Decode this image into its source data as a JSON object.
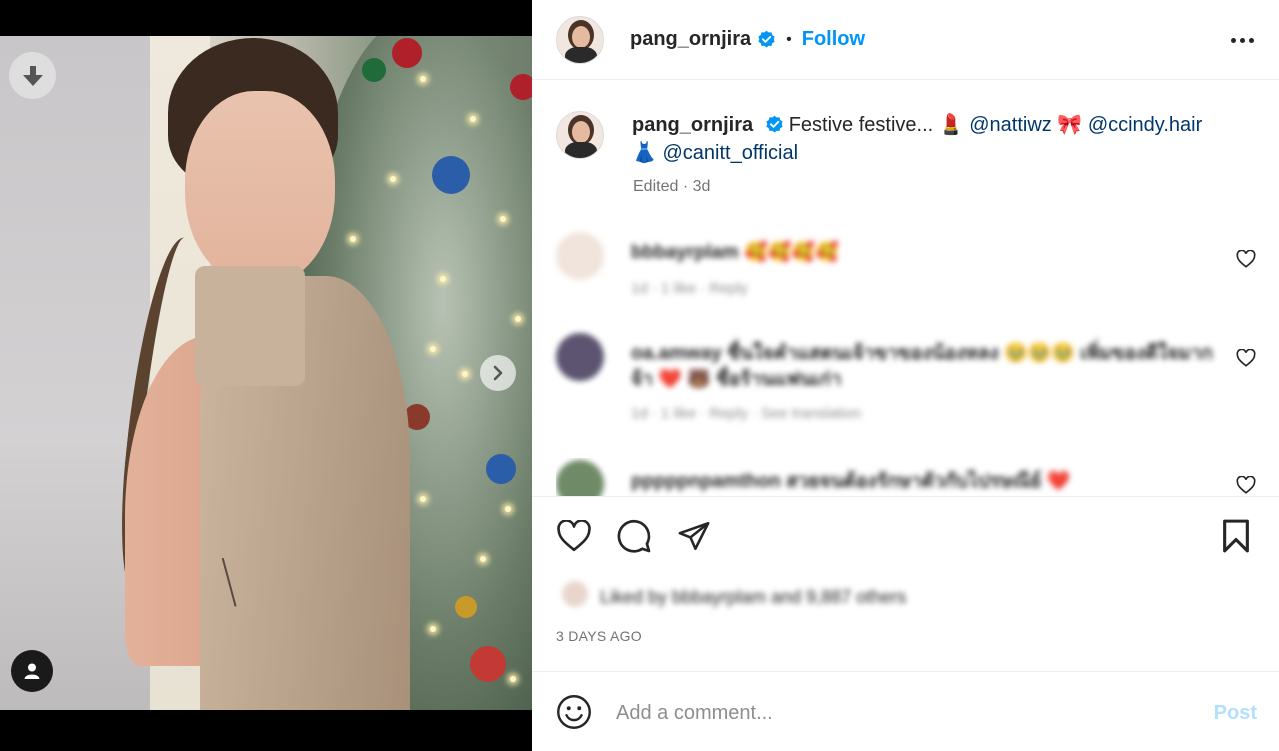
{
  "header": {
    "username": "pang_ornjira",
    "separator": "•",
    "follow_label": "Follow",
    "verified": true
  },
  "caption": {
    "username": "pang_ornjira",
    "text": "Festive festive... 💄",
    "mention_1": "@nattiwz",
    "emoji_1": " 🎀",
    "mention_2": "@ccindy.hair",
    "emoji_2": " 👗",
    "mention_3": "@canitt_official",
    "meta": "Edited · 3d"
  },
  "comments": [
    {
      "username": "bbbayrplam",
      "text": "🥰🥰🥰🥰",
      "meta": "1d · 1 like · Reply"
    },
    {
      "username": "oa.amway",
      "text": "ชื่นใจคำแสตนเจ้าขาของน้องหลง 🥹🥹🥹 เพิ่มของดีใจมากจ้า ❤️ 🐻 ชื่อร้านแฟนเก่า",
      "meta": "1d · 1 like · Reply · See translation"
    },
    {
      "username": "pppppnpamthon",
      "text": "สวยจนต้องรักษาตัวกับไปรษณีย์ ❤️",
      "meta": ""
    }
  ],
  "likes": {
    "text": "Liked by bbbayrplam and 9,887 others"
  },
  "date": "3 DAYS AGO",
  "add_comment": {
    "placeholder": "Add a comment...",
    "post_label": "Post"
  },
  "media": {
    "slide_count": 3,
    "active_slide": 1
  },
  "icons": {
    "download": "download-arrow-icon",
    "next": "chevron-right-icon",
    "tag": "user-tag-icon",
    "like": "heart-icon",
    "comment": "comment-bubble-icon",
    "share": "paper-plane-icon",
    "save": "bookmark-icon",
    "more": "more-options-icon",
    "emoji": "emoji-smile-icon"
  },
  "colors": {
    "accent": "#0095f6",
    "mention": "#00376b",
    "muted": "#737373",
    "post_disabled": "#b2dffc"
  }
}
